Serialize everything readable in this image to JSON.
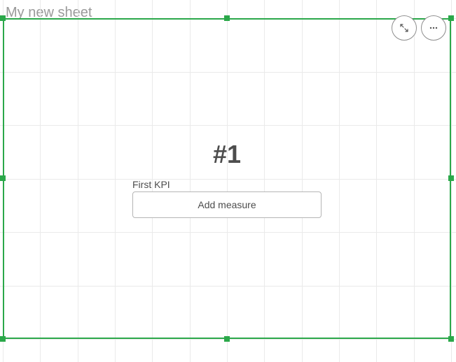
{
  "title": "My new sheet",
  "toolbar": {
    "fullscreen_icon": "fullscreen",
    "more_icon": "more"
  },
  "kpi": {
    "header": "#1",
    "label": "First KPI",
    "add_measure_label": "Add measure"
  },
  "colors": {
    "selection": "#2ba84a"
  }
}
